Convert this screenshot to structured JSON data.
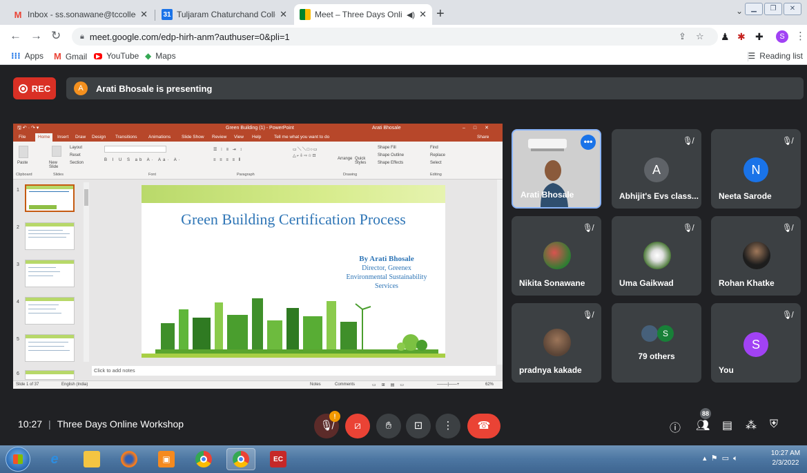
{
  "browser": {
    "tabs": [
      {
        "title": "Inbox - ss.sonawane@tccollege.c",
        "favicon": "gmail-icon",
        "active": false
      },
      {
        "title": "Tuljaram Chaturchand College of",
        "favicon": "site-icon",
        "active": false
      },
      {
        "title": "Meet – Three Days Online W",
        "favicon": "meet-icon",
        "active": true
      }
    ],
    "new_tab": "+",
    "url": "meet.google.com/edp-hirh-anm?authuser=0&pli=1",
    "profile_letter": "S",
    "bookmarks": [
      {
        "label": "Apps",
        "icon": "apps-grid-icon"
      },
      {
        "label": "Gmail",
        "icon": "gmail-icon"
      },
      {
        "label": "YouTube",
        "icon": "youtube-icon"
      },
      {
        "label": "Maps",
        "icon": "maps-icon"
      }
    ],
    "reading_list": "Reading list"
  },
  "meet": {
    "rec_label": "REC",
    "presenter_initial": "A",
    "presenting_text": "Arati Bhosale is presenting",
    "clock": "10:27",
    "meeting_title": "Three Days Online Workshop",
    "participants_count": "88",
    "mic_badge": "!",
    "participants": [
      {
        "name": "Arati Bhosale",
        "type": "video"
      },
      {
        "name": "Abhijit's Evs class...",
        "initial": "A",
        "color": "#5f6368"
      },
      {
        "name": "Neeta Sarode",
        "initial": "N",
        "color": "#1a73e8"
      },
      {
        "name": "Nikita Sonawane",
        "type": "photo"
      },
      {
        "name": "Uma Gaikwad",
        "type": "photo"
      },
      {
        "name": "Rohan Khatke",
        "type": "photo"
      },
      {
        "name": "pradnya kakade",
        "type": "photo"
      },
      {
        "name": "79 others",
        "initial": "S",
        "color": "#188038"
      },
      {
        "name": "You",
        "initial": "S",
        "color": "#a142f4"
      }
    ]
  },
  "ppt": {
    "window_title": "Green Building (1) - PowerPoint",
    "user": "Arati Bhosale",
    "tabs": [
      "File",
      "Home",
      "Insert",
      "Draw",
      "Design",
      "Transitions",
      "Animations",
      "Slide Show",
      "Review",
      "View",
      "Help",
      "Tell me what you want to do",
      "Share"
    ],
    "ribbon": {
      "paste": "Paste",
      "layout": "Layout",
      "reset": "Reset",
      "new_slide": "New Slide",
      "section": "Section",
      "arrange": "Arrange",
      "quick_styles": "Quick Styles",
      "shape_fill": "Shape Fill",
      "shape_outline": "Shape Outline",
      "shape_effects": "Shape Effects",
      "find": "Find",
      "replace": "Replace",
      "select": "Select",
      "groups": [
        "Clipboard",
        "Slides",
        "Font",
        "Paragraph",
        "Drawing",
        "Editing"
      ]
    },
    "slide_numbers": [
      "1",
      "2",
      "3",
      "4",
      "5",
      "6"
    ],
    "slide": {
      "title": "Green Building Certification Process",
      "author_line": "By Arati Bhosale",
      "role_line1": "Director, Greenex",
      "role_line2": "Environmental Sustainability",
      "role_line3": "Services"
    },
    "notes_placeholder": "Click to add notes",
    "status": {
      "slide_of": "Slide 1 of 37",
      "language": "English (India)",
      "notes": "Notes",
      "comments": "Comments",
      "zoom": "62%"
    }
  },
  "taskbar": {
    "time": "10:27 AM",
    "date": "2/3/2022"
  }
}
